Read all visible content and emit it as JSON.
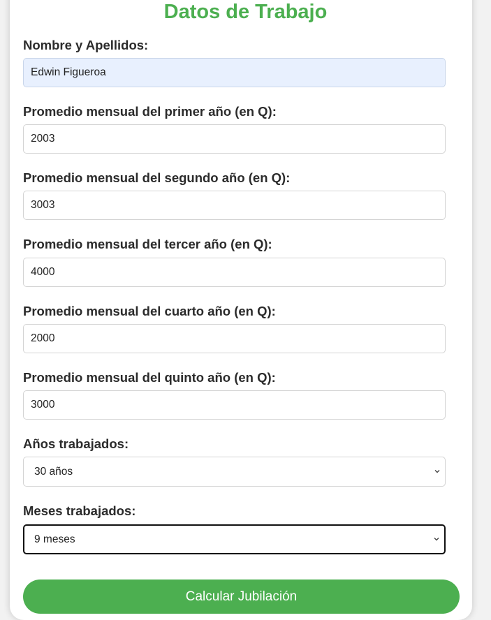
{
  "form": {
    "title": "Datos de Trabajo",
    "name_label": "Nombre y Apellidos:",
    "name_value": "Edwin Figueroa",
    "year1_label": "Promedio mensual del primer año (en Q):",
    "year1_value": "2003",
    "year2_label": "Promedio mensual del segundo año (en Q):",
    "year2_value": "3003",
    "year3_label": "Promedio mensual del tercer año (en Q):",
    "year3_value": "4000",
    "year4_label": "Promedio mensual del cuarto año (en Q):",
    "year4_value": "2000",
    "year5_label": "Promedio mensual del quinto año (en Q):",
    "year5_value": "3000",
    "years_label": "Años trabajados:",
    "years_selected": "30 años",
    "months_label": "Meses trabajados:",
    "months_selected": "9 meses",
    "submit_label": "Calcular Jubilación"
  },
  "colors": {
    "accent": "#4caf50",
    "autofill_bg": "#e8f0fe",
    "text": "#2b2b2b"
  },
  "icons": {
    "select_arrow": "chevron-down-icon"
  }
}
